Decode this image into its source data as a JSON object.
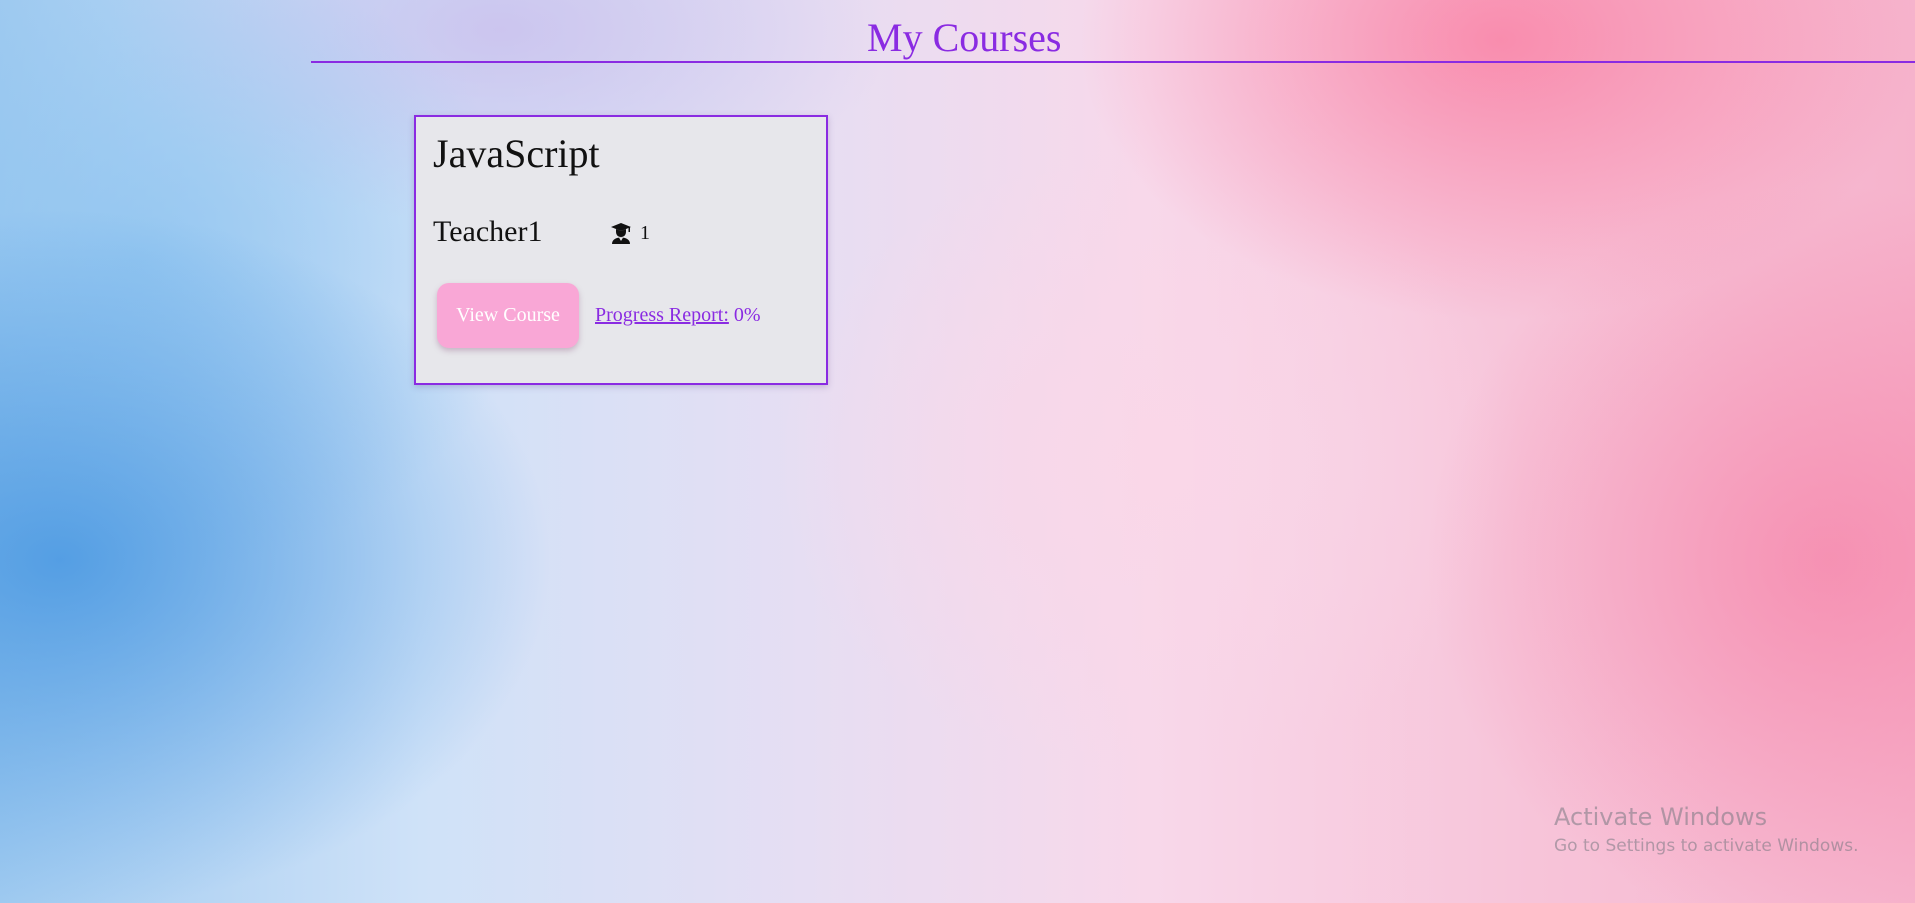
{
  "page": {
    "title": "My Courses"
  },
  "course_cards": [
    {
      "title": "JavaScript",
      "teacher": "Teacher1",
      "student_icon": "graduate-student-icon",
      "student_count": "1",
      "view_button_label": "View Course",
      "progress_label": "Progress Report:",
      "progress_value": "0%"
    }
  ],
  "watermark": {
    "title": "Activate Windows",
    "subtitle": "Go to Settings to activate Windows."
  },
  "colors": {
    "accent": "#8a2be2",
    "card_background": "#e7e7eb",
    "button_background": "#f9a7d6",
    "button_text": "#ffffff"
  }
}
